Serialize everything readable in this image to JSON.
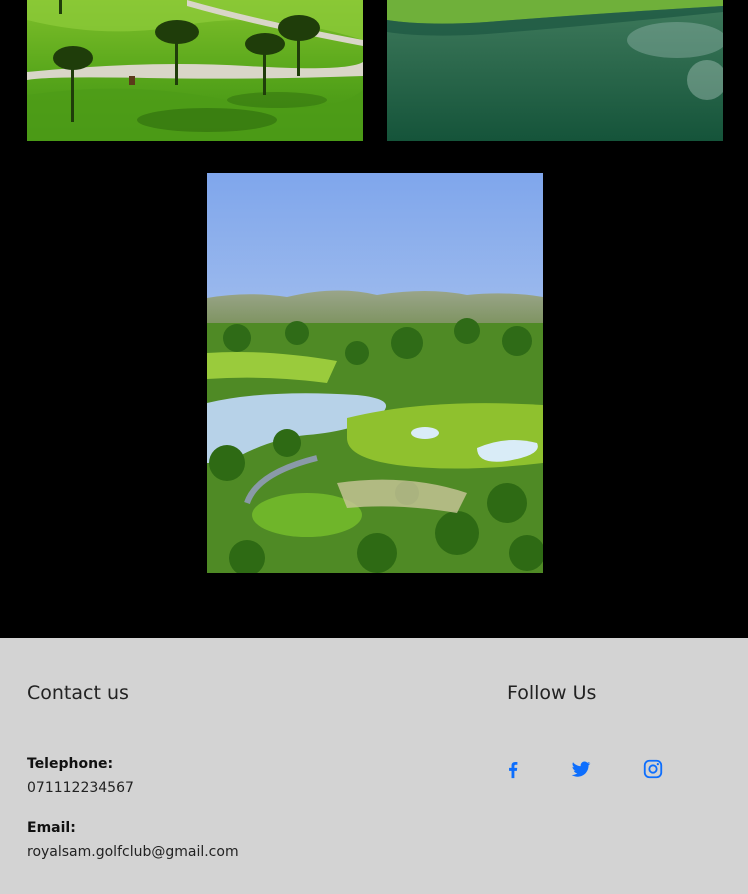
{
  "gallery": {
    "photos": [
      {
        "subject": "golf-course-trees-photo"
      },
      {
        "subject": "golf-course-lake-photo"
      },
      {
        "subject": "aerial-golf-course-photo"
      }
    ]
  },
  "footer": {
    "contact_title": "Contact us",
    "telephone_label": "Telephone:",
    "telephone_value": "071112234567",
    "email_label": "Email:",
    "email_value": "royalsam.golfclub@gmail.com",
    "follow_title": "Follow Us",
    "social_icons": [
      "facebook-icon",
      "twitter-icon",
      "instagram-icon"
    ],
    "icon_color": "#0d6efd",
    "background": "#d3d3d3"
  }
}
